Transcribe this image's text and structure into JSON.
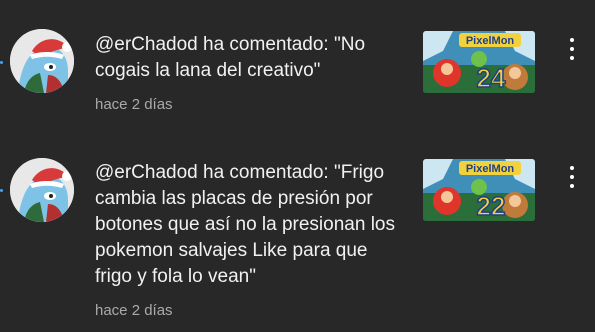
{
  "notifications": [
    {
      "message": "@erChadod ha comentado: \"No cogais la lana del creativo\"",
      "time": "hace 2 días",
      "thumbnail": {
        "title_text": "PixelMon",
        "episode": "24"
      },
      "icons": {
        "avatar": "avatar-icon",
        "more": "more-vert-icon"
      }
    },
    {
      "message": "@erChadod ha comentado: \"Frigo cambia las placas de presión por botones que así no la presionan los pokemon salvajes Like para que frigo y fola lo vean\"",
      "time": "hace 2 días",
      "thumbnail": {
        "title_text": "PixelMon",
        "episode": "22"
      },
      "icons": {
        "avatar": "avatar-icon",
        "more": "more-vert-icon"
      }
    }
  ],
  "colors": {
    "background": "#282828",
    "text_primary": "#f1f1f1",
    "text_secondary": "#aaaaaa",
    "unread_dot": "#3ea6ff"
  }
}
